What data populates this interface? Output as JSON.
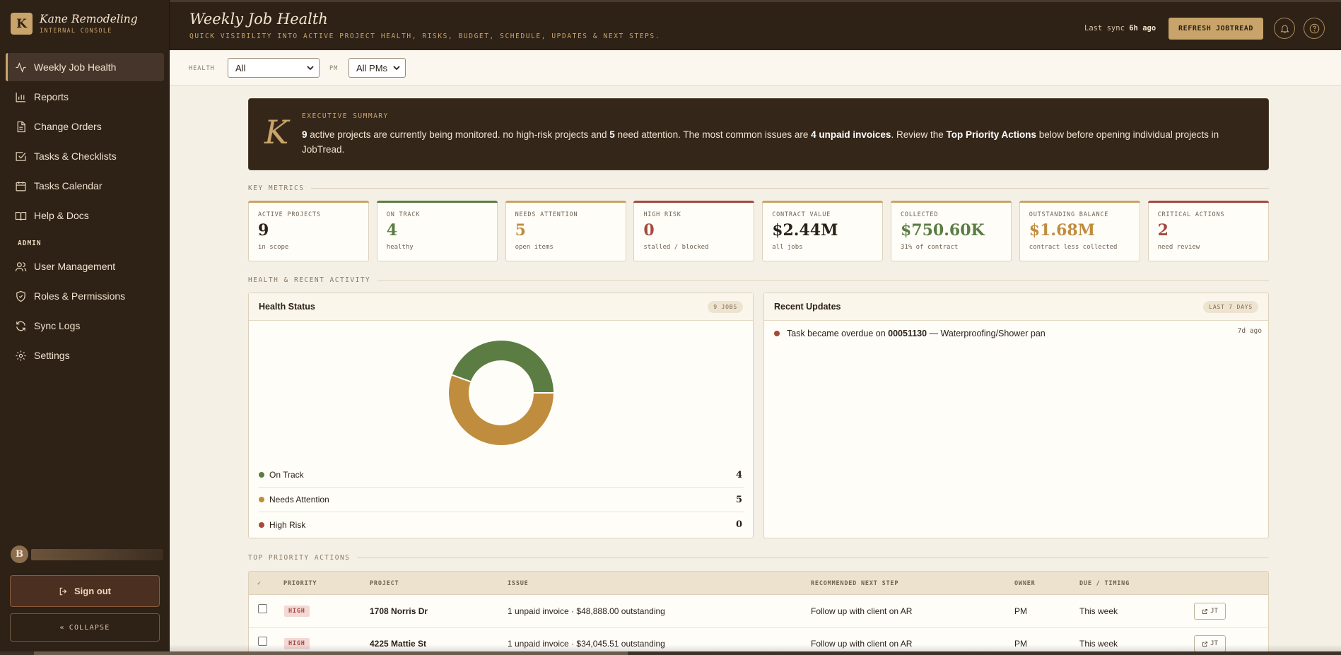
{
  "brand": {
    "logo_letter": "K",
    "name": "Kane Remodeling",
    "subtitle": "INTERNAL CONSOLE"
  },
  "sidebar": {
    "items": [
      {
        "label": "Weekly Job Health",
        "icon": "activity-icon",
        "active": true
      },
      {
        "label": "Reports",
        "icon": "bar-chart-icon"
      },
      {
        "label": "Change Orders",
        "icon": "document-icon"
      },
      {
        "label": "Tasks & Checklists",
        "icon": "checkbox-icon"
      },
      {
        "label": "Tasks Calendar",
        "icon": "calendar-icon"
      },
      {
        "label": "Help & Docs",
        "icon": "book-icon"
      }
    ],
    "admin_heading": "ADMIN",
    "admin_items": [
      {
        "label": "User Management",
        "icon": "users-icon"
      },
      {
        "label": "Roles & Permissions",
        "icon": "shield-icon"
      },
      {
        "label": "Sync Logs",
        "icon": "refresh-icon"
      },
      {
        "label": "Settings",
        "icon": "gear-icon"
      }
    ],
    "user_initial": "B",
    "sign_out": "Sign out",
    "collapse": "COLLAPSE"
  },
  "header": {
    "title": "Weekly Job Health",
    "subtitle": "QUICK VISIBILITY INTO ACTIVE PROJECT HEALTH, RISKS, BUDGET, SCHEDULE, UPDATES & NEXT STEPS.",
    "sync_label": "Last sync",
    "sync_value": "6h ago",
    "refresh_button": "REFRESH JOBTREAD"
  },
  "filters": {
    "health_label": "HEALTH",
    "health_value": "All",
    "pm_label": "PM",
    "pm_value": "All PMs"
  },
  "executive_summary": {
    "logo_letter": "K",
    "label": "EXECUTIVE SUMMARY",
    "active_count": "9",
    "t1": " active projects are currently being monitored. no high-risk projects and ",
    "attention_count": "5",
    "t2": " need attention. The most common issues are ",
    "common_issue": "4 unpaid invoices",
    "t3": ". Review the ",
    "priority_ref": "Top Priority Actions",
    "t4": " below before opening individual projects in JobTread."
  },
  "sections": {
    "key_metrics": "KEY METRICS",
    "health_activity": "HEALTH & RECENT ACTIVITY",
    "top_priority": "TOP PRIORITY ACTIONS"
  },
  "metrics": [
    {
      "label": "ACTIVE PROJECTS",
      "value": "9",
      "sub": "in scope",
      "accent": "gold",
      "value_color": "#2a2118"
    },
    {
      "label": "ON TRACK",
      "value": "4",
      "sub": "healthy",
      "accent": "green",
      "value_color": "#5b7d43"
    },
    {
      "label": "NEEDS ATTENTION",
      "value": "5",
      "sub": "open items",
      "accent": "gold",
      "value_color": "#c08d3e"
    },
    {
      "label": "HIGH RISK",
      "value": "0",
      "sub": "stalled / blocked",
      "accent": "red",
      "value_color": "#a44a3f"
    },
    {
      "label": "CONTRACT VALUE",
      "value": "$2.44M",
      "sub": "all jobs",
      "accent": "gold",
      "value_color": "#2a2118"
    },
    {
      "label": "COLLECTED",
      "value": "$750.60K",
      "sub": "31% of contract",
      "accent": "gold",
      "value_color": "#5b7d43"
    },
    {
      "label": "OUTSTANDING BALANCE",
      "value": "$1.68M",
      "sub": "contract less collected",
      "accent": "gold",
      "value_color": "#c08d3e"
    },
    {
      "label": "CRITICAL ACTIONS",
      "value": "2",
      "sub": "need review",
      "accent": "red",
      "value_color": "#a44a3f"
    }
  ],
  "health_status": {
    "title": "Health Status",
    "badge": "9 JOBS",
    "legend": [
      {
        "label": "On Track",
        "count": "4",
        "color": "#5b7d43"
      },
      {
        "label": "Needs Attention",
        "count": "5",
        "color": "#c08d3e"
      },
      {
        "label": "High Risk",
        "count": "0",
        "color": "#a44a3f"
      }
    ]
  },
  "chart_data": {
    "type": "pie",
    "categories": [
      "On Track",
      "Needs Attention",
      "High Risk"
    ],
    "values": [
      4,
      5,
      0
    ],
    "colors": [
      "#5b7d43",
      "#c08d3e",
      "#a44a3f"
    ],
    "donut": true
  },
  "recent_updates": {
    "title": "Recent Updates",
    "badge": "LAST 7 DAYS",
    "items": [
      {
        "prefix": "Task became overdue on ",
        "job": "00051130",
        "suffix": " — Waterproofing/Shower pan",
        "time": "7d ago",
        "color": "#a44a3f"
      }
    ]
  },
  "priority_table": {
    "check_header": "✓",
    "columns": [
      "PRIORITY",
      "PROJECT",
      "ISSUE",
      "RECOMMENDED NEXT STEP",
      "OWNER",
      "DUE / TIMING"
    ],
    "rows": [
      {
        "priority": "HIGH",
        "project": "1708 Norris Dr",
        "issue": "1 unpaid invoice · $48,888.00 outstanding",
        "next_step": "Follow up with client on AR",
        "owner": "PM",
        "due": "This week",
        "link": "JT"
      },
      {
        "priority": "HIGH",
        "project": "4225 Mattie St",
        "issue": "1 unpaid invoice · $34,045.51 outstanding",
        "next_step": "Follow up with client on AR",
        "owner": "PM",
        "due": "This week",
        "link": "JT"
      }
    ]
  }
}
